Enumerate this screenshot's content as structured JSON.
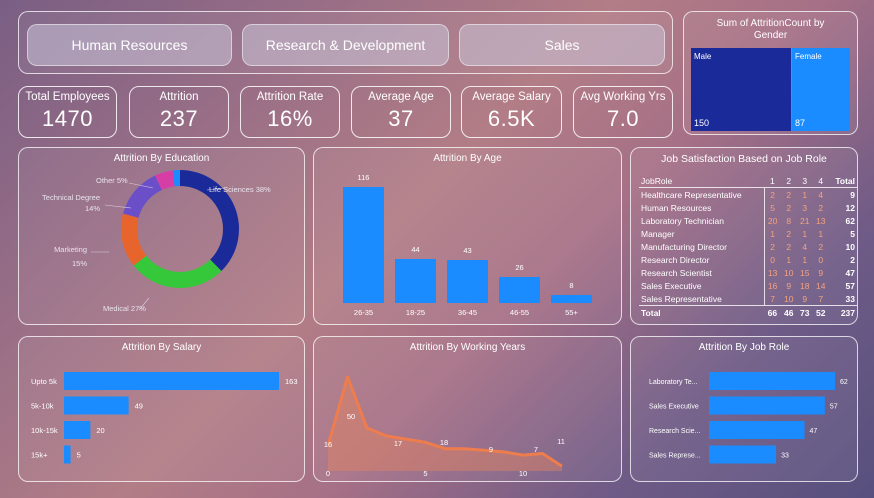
{
  "slicers": [
    "Human Resources",
    "Research & Development",
    "Sales"
  ],
  "kpis": [
    {
      "label": "Total Employees",
      "value": "1470"
    },
    {
      "label": "Attrition",
      "value": "237"
    },
    {
      "label": "Attrition Rate",
      "value": "16%"
    },
    {
      "label": "Average Age",
      "value": "37"
    },
    {
      "label": "Average Salary",
      "value": "6.5K"
    },
    {
      "label": "Avg Working Yrs",
      "value": "7.0"
    }
  ],
  "gender": {
    "title": "Sum of AttritionCount by Gender",
    "male_label": "Male",
    "male_value": "150",
    "female_label": "Female",
    "female_value": "87",
    "colors": {
      "male": "#1b2a99",
      "female": "#1a8cff"
    }
  },
  "education": {
    "title": "Attrition By Education"
  },
  "age": {
    "title": "Attrition By Age"
  },
  "jobsat": {
    "title": "Job Satisfaction Based on Job Role",
    "headers": [
      "JobRole",
      "1",
      "2",
      "3",
      "4",
      "Total"
    ],
    "rows": [
      [
        "Healthcare Representative",
        "2",
        "2",
        "1",
        "4",
        "9"
      ],
      [
        "Human Resources",
        "5",
        "2",
        "3",
        "2",
        "12"
      ],
      [
        "Laboratory Technician",
        "20",
        "8",
        "21",
        "13",
        "62"
      ],
      [
        "Manager",
        "1",
        "2",
        "1",
        "1",
        "5"
      ],
      [
        "Manufacturing Director",
        "2",
        "2",
        "4",
        "2",
        "10"
      ],
      [
        "Research Director",
        "0",
        "1",
        "1",
        "0",
        "2"
      ],
      [
        "Research Scientist",
        "13",
        "10",
        "15",
        "9",
        "47"
      ],
      [
        "Sales Executive",
        "16",
        "9",
        "18",
        "14",
        "57"
      ],
      [
        "Sales Representative",
        "7",
        "10",
        "9",
        "7",
        "33"
      ]
    ],
    "total": [
      "Total",
      "66",
      "46",
      "73",
      "52",
      "237"
    ]
  },
  "salary": {
    "title": "Attrition By Salary"
  },
  "years": {
    "title": "Attrition By Working Years"
  },
  "jobrole": {
    "title": "Attrition By Job Role"
  },
  "chart_data": [
    {
      "type": "bar",
      "id": "gender",
      "orientation": "treemap",
      "categories": [
        "Male",
        "Female"
      ],
      "values": [
        150,
        87
      ],
      "title": "Sum of AttritionCount by Gender"
    },
    {
      "type": "pie",
      "id": "education",
      "title": "Attrition By Education",
      "categories": [
        "Life Sciences",
        "Medical",
        "Marketing",
        "Technical Degree",
        "Other",
        ""
      ],
      "labels": [
        "Life Sciences 38%",
        "Medical 27%",
        "Marketing 15%",
        "Technical Degree 14%",
        "Other 5%",
        ""
      ],
      "values": [
        38,
        27,
        15,
        14,
        5,
        2
      ],
      "colors": [
        "#1b2a99",
        "#35c83b",
        "#e8642d",
        "#6b4fc9",
        "#d63ea6",
        "#1a8cff"
      ]
    },
    {
      "type": "bar",
      "id": "age",
      "title": "Attrition By Age",
      "categories": [
        "26-35",
        "18-25",
        "36-45",
        "46-55",
        "55+"
      ],
      "values": [
        116,
        44,
        43,
        26,
        8
      ],
      "ylim": [
        0,
        116
      ]
    },
    {
      "type": "bar",
      "id": "salary",
      "orientation": "horizontal",
      "title": "Attrition By Salary",
      "categories": [
        "Upto 5k",
        "5k-10k",
        "10k-15k",
        "15k+"
      ],
      "values": [
        163,
        49,
        20,
        5
      ]
    },
    {
      "type": "area",
      "id": "years",
      "title": "Attrition By Working Years",
      "x": [
        0,
        1,
        2,
        3,
        4,
        5,
        6,
        7,
        8,
        9,
        10,
        11,
        12
      ],
      "values": [
        16,
        59,
        27,
        22,
        20,
        18,
        14,
        14,
        13,
        12,
        10,
        11,
        3
      ],
      "point_labels": {
        "0": "16",
        "1": "50",
        "3": "17",
        "5": "18",
        "7": "9",
        "9": "7",
        "11": "11"
      },
      "xticks": [
        "0",
        "5",
        "10"
      ]
    },
    {
      "type": "bar",
      "id": "jobrole",
      "orientation": "horizontal",
      "title": "Attrition By Job Role",
      "categories": [
        "Laboratory Te...",
        "Sales Executive",
        "Research Scie...",
        "Sales Represe..."
      ],
      "values": [
        62,
        57,
        47,
        33
      ]
    }
  ]
}
